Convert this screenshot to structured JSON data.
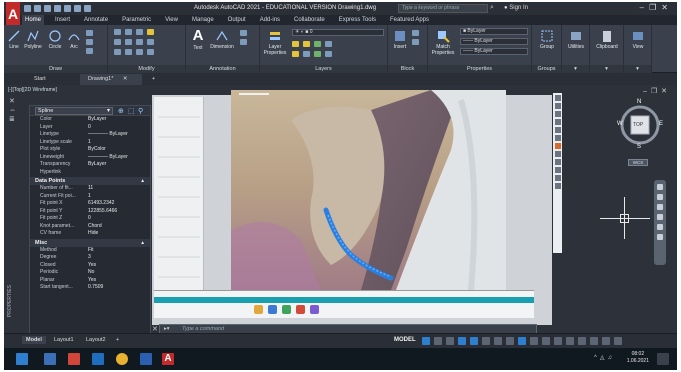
{
  "window": {
    "title": "Autodesk AutoCAD 2021 - EDUCATIONAL VERSION    Drawing1.dwg",
    "search_placeholder": "Type a keyword or phrase",
    "sign_in": "Sign In"
  },
  "ribbon_tabs": [
    "Home",
    "Insert",
    "Annotate",
    "Parametric",
    "View",
    "Manage",
    "Output",
    "Add-ins",
    "Collaborate",
    "Express Tools",
    "Featured Apps"
  ],
  "ribbon": {
    "draw_tools": [
      "Line",
      "Polyline",
      "Circle",
      "Arc"
    ],
    "draw_panel": "Draw",
    "modify_panel": "Modify",
    "text_label": "Text",
    "dimension_label": "Dimension",
    "annotation_panel": "Annotation",
    "layer_properties": "Layer Properties",
    "layers_panel": "Layers",
    "layer_value": "0",
    "insert_label": "Insert",
    "block_panel": "Block",
    "match_properties": "Match Properties",
    "bylayer_color": "ByLayer",
    "bylayer_linetype": "ByLayer",
    "bylayer_lineweight": "ByLayer",
    "properties_panel": "Properties",
    "group_label": "Group",
    "groups_panel": "Groups",
    "utilities": "Utilities",
    "clipboard": "Clipboard",
    "view": "View"
  },
  "file_tabs": [
    "Start",
    "Drawing1*"
  ],
  "viewport_label": "[-][Top][2D Wireframe]",
  "properties": {
    "object_type": "Spline",
    "general": [
      {
        "k": "Color",
        "v": "ByLayer"
      },
      {
        "k": "Layer",
        "v": "0"
      },
      {
        "k": "Linetype",
        "v": "———— ByLayer"
      },
      {
        "k": "Linetype scale",
        "v": "1"
      },
      {
        "k": "Plot style",
        "v": "ByColor"
      },
      {
        "k": "Lineweight",
        "v": "———— ByLayer"
      },
      {
        "k": "Transparency",
        "v": "ByLayer"
      },
      {
        "k": "Hyperlink",
        "v": ""
      }
    ],
    "data_points_title": "Data Points",
    "data_points": [
      {
        "k": "Number of fit...",
        "v": "11"
      },
      {
        "k": "Current Fit poi...",
        "v": "1"
      },
      {
        "k": "Fit point X",
        "v": "61493.2342"
      },
      {
        "k": "Fit point Y",
        "v": "122855.6466"
      },
      {
        "k": "Fit point Z",
        "v": "0"
      },
      {
        "k": "Knot paramet...",
        "v": "Chord"
      },
      {
        "k": "CV frame",
        "v": "Hide"
      }
    ],
    "misc_title": "Misc",
    "misc": [
      {
        "k": "Method",
        "v": "Fit"
      },
      {
        "k": "Degree",
        "v": "3"
      },
      {
        "k": "Closed",
        "v": "Yes"
      },
      {
        "k": "Periodic",
        "v": "No"
      },
      {
        "k": "Planar",
        "v": "Yes"
      },
      {
        "k": "Start tangent...",
        "v": "0.7509"
      }
    ],
    "side_label": "PROPERTIES"
  },
  "viewcube": {
    "n": "N",
    "s": "S",
    "e": "E",
    "w": "W",
    "face": "TOP",
    "wcs": "WCS"
  },
  "command_placeholder": "Type a command",
  "layout_tabs": [
    "Model",
    "Layout1",
    "Layout2"
  ],
  "status_model": "MODEL",
  "taskbar": {
    "time": "08:02",
    "date": "1.06.2021"
  }
}
